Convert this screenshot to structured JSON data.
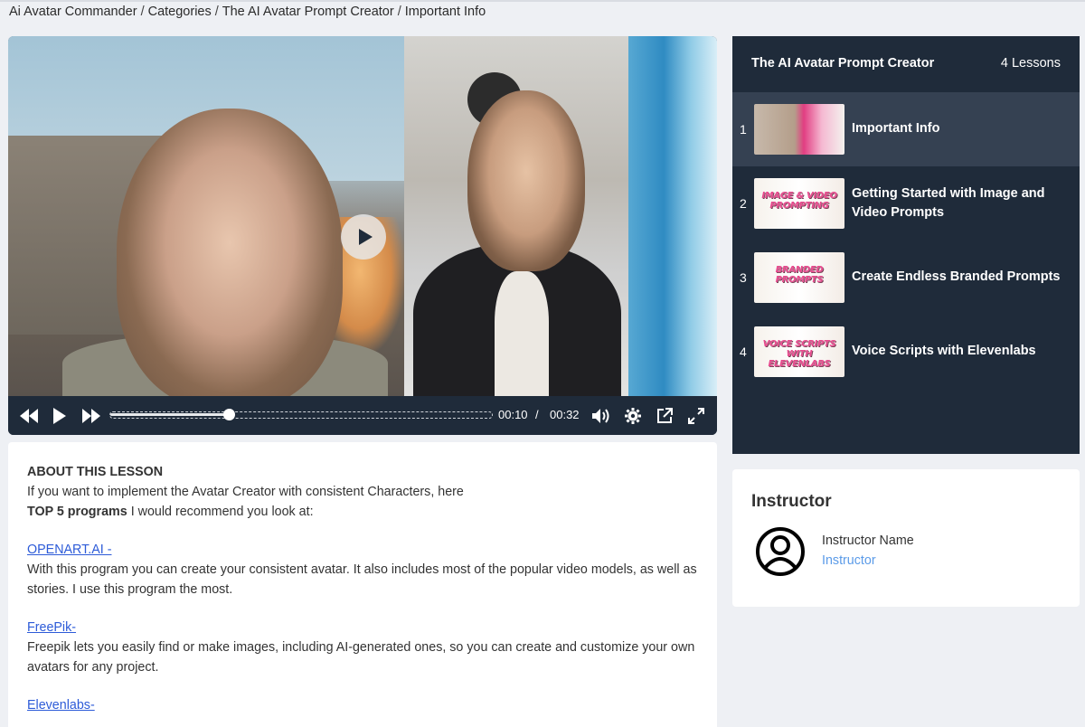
{
  "breadcrumb": {
    "items": [
      "Ai Avatar Commander",
      "Categories",
      "The AI Avatar Prompt Creator",
      "Important Info"
    ],
    "separator": "/"
  },
  "video": {
    "current_time": "00:10",
    "time_separator": "/",
    "duration": "00:32",
    "progress_fraction": 0.31,
    "icons": [
      "rewind-icon",
      "play-icon",
      "fast-forward-icon",
      "volume-icon",
      "settings-icon",
      "popout-icon",
      "fullscreen-icon"
    ]
  },
  "lesson": {
    "heading": "ABOUT THIS LESSON",
    "intro": "If you want to implement the Avatar Creator with consistent Characters, here",
    "top_programs_bold": "TOP 5 programs",
    "top_programs_rest": " I would recommend you look at:",
    "programs": [
      {
        "link": "OPENART.AI -",
        "description": "With this program you can create your consistent avatar. It also includes most of the popular video models, as well as stories. I use this program the most."
      },
      {
        "link": "FreePik-",
        "description": "Freepik lets you easily find or make images, including AI-generated ones, so you can create and customize your own avatars for any project."
      },
      {
        "link": "Elevenlabs-",
        "description": ""
      }
    ]
  },
  "playlist": {
    "title": "The AI Avatar Prompt Creator",
    "count": "4 Lessons",
    "items": [
      {
        "number": "1",
        "label": "Important Info",
        "thumb_text": "",
        "active": true
      },
      {
        "number": "2",
        "label": "Getting Started with Image and Video Prompts",
        "thumb_text": "IMAGE & VIDEO PROMPTING",
        "active": false
      },
      {
        "number": "3",
        "label": "Create Endless Branded Prompts",
        "thumb_text": "BRANDED PROMPTS",
        "active": false
      },
      {
        "number": "4",
        "label": "Voice Scripts with Elevenlabs",
        "thumb_text": "VOICE SCRIPTS WITH ELEVENLABS",
        "active": false
      }
    ]
  },
  "instructor": {
    "title": "Instructor",
    "name": "Instructor Name",
    "role": "Instructor",
    "avatar_icon": "user-circle-icon"
  },
  "colors": {
    "page_bg": "#eef0f4",
    "panel_dark": "#1f2b3a",
    "active_item": "#354152",
    "link": "#2d5bd8",
    "instructor_role": "#5b9be8"
  }
}
